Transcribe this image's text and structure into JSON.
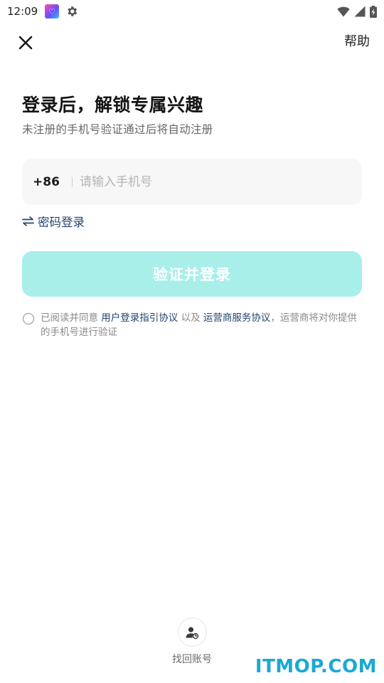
{
  "status_bar": {
    "time": "12:09",
    "app_badge_icon": "gallery-app-icon",
    "settings_icon": "gear-icon",
    "wifi_icon": "wifi-icon",
    "signal_icon": "signal-icon",
    "battery_icon": "battery-charging-icon"
  },
  "header": {
    "close_icon": "close-icon",
    "help_label": "帮助"
  },
  "title": "登录后，解锁专属兴趣",
  "subtitle": "未注册的手机号验证通过后将自动注册",
  "phone": {
    "country_code": "+86",
    "value": "",
    "placeholder": "请输入手机号"
  },
  "password_login": {
    "icon": "swap-arrows-icon",
    "label": "密码登录"
  },
  "submit_label": "验证并登录",
  "agreement": {
    "checked": false,
    "prefix": "已阅读并同意",
    "link1": "用户登录指引协议",
    "middle": "以及",
    "link2": "运营商服务协议",
    "suffix": "，运营商将对你提供的手机号进行验证"
  },
  "recover": {
    "icon": "user-refresh-icon",
    "label": "找回账号"
  },
  "watermark": "ITMOP.COM",
  "colors": {
    "accent_button": "#a8efea",
    "link": "#23466f",
    "input_bg": "#f7f7f7"
  }
}
